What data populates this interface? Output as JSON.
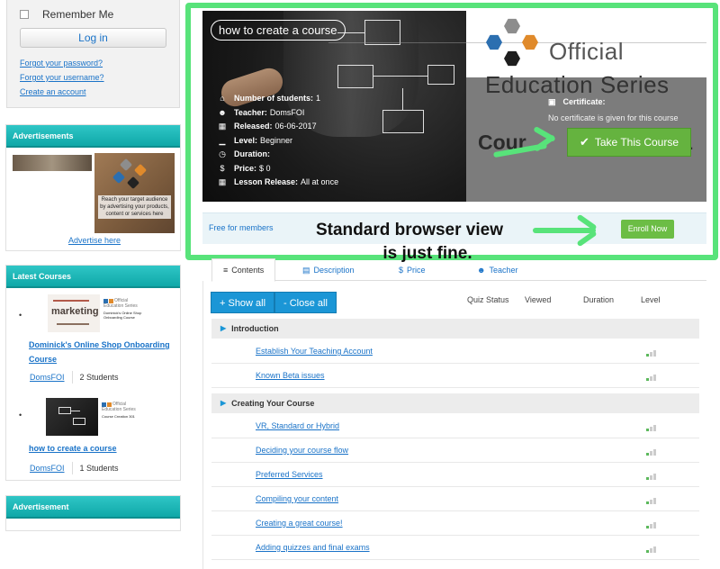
{
  "sidebar": {
    "login": {
      "remember_me": "Remember Me",
      "login_button": "Log in",
      "forgot_password": "Forgot your password?",
      "forgot_username": "Forgot your username?",
      "create_account": "Create an account"
    },
    "advertisements": {
      "heading": "Advertisements",
      "ad_text": "Reach your target audience by advertising your products, content or services here",
      "advertise_link": "Advertise here"
    },
    "latest_courses": {
      "heading": "Latest Courses",
      "items": [
        {
          "thumb_word": "marketing",
          "thumb_official": "Official",
          "thumb_series": "Education Series",
          "thumb_subtitle": "Dominick's Online Shop Onboarding Course",
          "title": "Dominick's Online Shop Onboarding Course",
          "author": "DomsFOI",
          "students": "2 Students"
        },
        {
          "thumb_official": "Official",
          "thumb_series": "Education Series",
          "thumb_subtitle": "Course Creation 301",
          "title": "how to create a course",
          "author": "DomsFOI",
          "students": "1 Students"
        }
      ]
    },
    "advertisement2": {
      "heading": "Advertisement"
    }
  },
  "hero": {
    "course_title": "how to create a course",
    "logo_official": "Official",
    "logo_series": "Education Series",
    "stats": [
      {
        "icon": "graduation-cap-icon",
        "glyph": "⌂",
        "label": "Number of students:",
        "value": "1"
      },
      {
        "icon": "user-icon",
        "glyph": "☻",
        "label": "Teacher:",
        "value": "DomsFOI"
      },
      {
        "icon": "calendar-icon",
        "glyph": "▦",
        "label": "Released:",
        "value": "06-06-2017"
      },
      {
        "icon": "signal-icon",
        "glyph": "▁",
        "label": "Level:",
        "value": "Beginner"
      },
      {
        "icon": "clock-icon",
        "glyph": "◷",
        "label": "Duration:",
        "value": ""
      },
      {
        "icon": "dollar-icon",
        "glyph": "$",
        "label": "Price:",
        "value": "$ 0"
      },
      {
        "icon": "calendar-icon",
        "glyph": "▦",
        "label": "Lesson Release:",
        "value": "All at once"
      }
    ],
    "certificate_label": "Certificate:",
    "certificate_text": "No certificate is given for this course",
    "bg_course_text_left": "Cour",
    "bg_course_text_right": "1",
    "take_course_button": "Take This Course"
  },
  "enroll": {
    "free_label": "Free for members",
    "enroll_button": "Enroll Now"
  },
  "annotation": {
    "line1": "Standard browser view",
    "line2": "is just fine."
  },
  "tabs": [
    {
      "label": "Contents",
      "glyph": "≡"
    },
    {
      "label": "Description",
      "glyph": "▤"
    },
    {
      "label": "Price",
      "glyph": "$"
    },
    {
      "label": "Teacher",
      "glyph": "☻"
    }
  ],
  "contents": {
    "show_all": "+ Show all",
    "close_all": "- Close all",
    "columns": [
      "Quiz Status",
      "Viewed",
      "Duration",
      "Level"
    ],
    "sections": [
      {
        "title": "Introduction",
        "lessons": [
          "Establish Your Teaching Account",
          "Known Beta issues"
        ]
      },
      {
        "title": "Creating Your Course",
        "lessons": [
          "VR, Standard or Hybrid",
          "Deciding your course flow",
          "Preferred Services",
          "Compiling your content",
          "Creating a great course!",
          "Adding quizzes and final exams"
        ]
      }
    ]
  },
  "colors": {
    "accent_green": "#58e37a",
    "teal_header": "#1fb5b5",
    "button_blue": "#1b96d6",
    "take_course_green": "#65b33f"
  }
}
